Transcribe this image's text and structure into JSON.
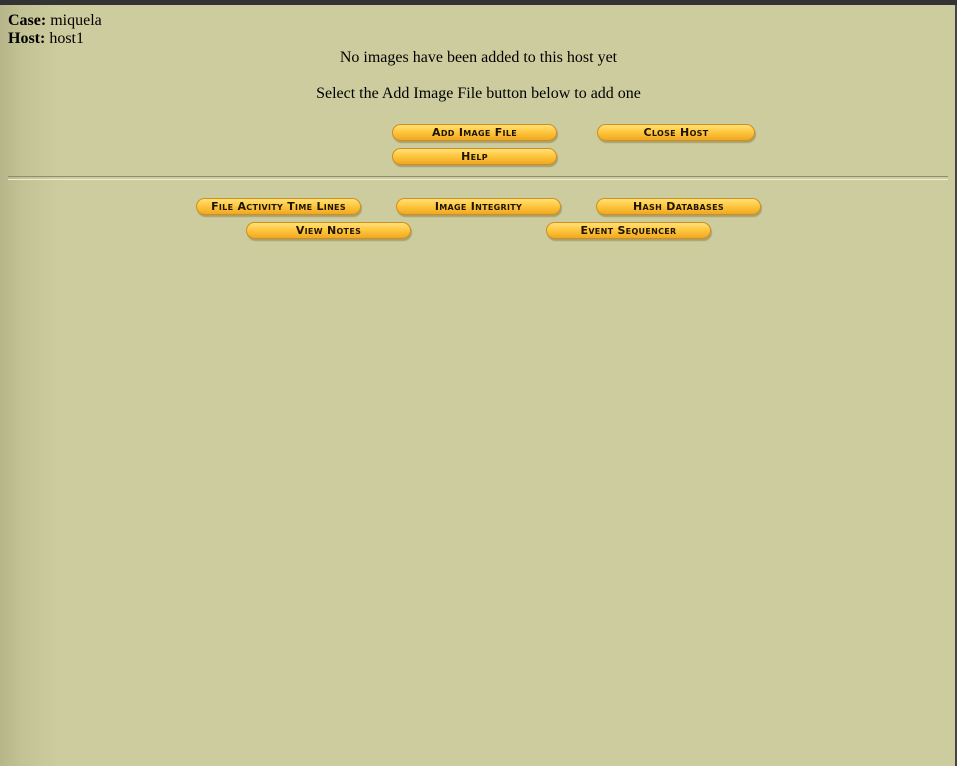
{
  "case": {
    "label": "Case:",
    "value": "miquela"
  },
  "host": {
    "label": "Host:",
    "value": "host1"
  },
  "messages": {
    "no_images": "No images have been added to this host yet",
    "instruction": "Select the Add Image File button below to add one"
  },
  "buttons": {
    "add_image_file": "Add Image File",
    "close_host": "Close Host",
    "help": "Help",
    "file_activity_time_lines": "File Activity Time Lines",
    "image_integrity": "Image Integrity",
    "hash_databases": "Hash Databases",
    "view_notes": "View Notes",
    "event_sequencer": "Event Sequencer"
  },
  "colors": {
    "background": "#cccc9e",
    "button_top": "#ffe07a",
    "button_bottom": "#f0a820",
    "top_bar": "#333333"
  }
}
